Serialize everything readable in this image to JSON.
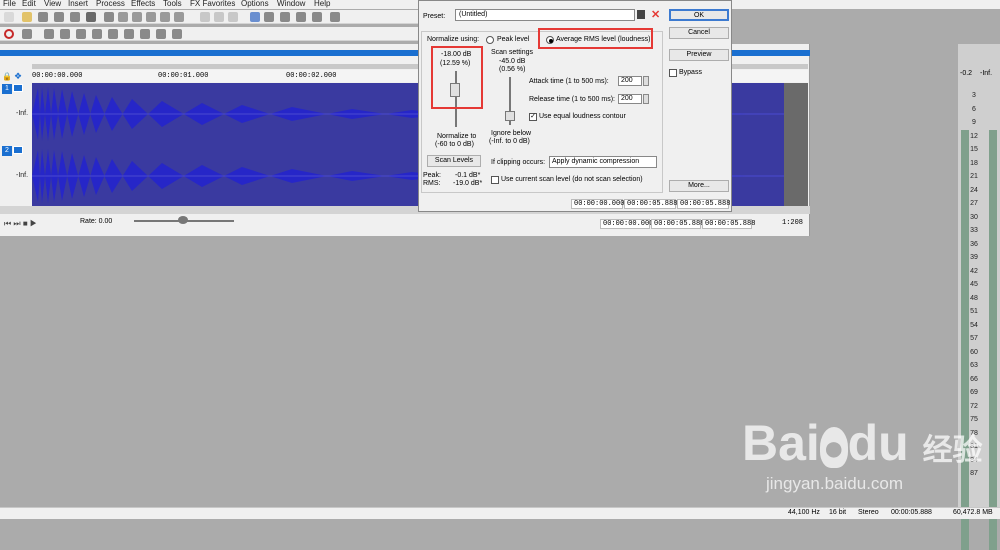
{
  "menu": [
    "File",
    "Edit",
    "View",
    "Insert",
    "Process",
    "Effects",
    "Tools",
    "FX Favorites",
    "Options",
    "Window",
    "Help"
  ],
  "timeline": {
    "ruler_ticks": [
      "00:00:00.000",
      "00:00:01.000",
      "00:00:02.000"
    ],
    "track1": {
      "number": "1",
      "peak_label": "-Inf."
    },
    "track2": {
      "number": "2",
      "peak_label": "-Inf."
    },
    "rate_label": "Rate: 0.00",
    "selection_start": "00:00:00.000",
    "selection_end": "00:00:05.888",
    "selection_length": "00:00:05.888",
    "zoom_ratio": "1:208"
  },
  "dialog": {
    "preset_label": "Preset:",
    "preset_value": "(Untitled)",
    "ok": "OK",
    "cancel": "Cancel",
    "preview": "Preview",
    "bypass": "Bypass",
    "more": "More...",
    "normalize_using": "Normalize using:",
    "normalize_db": "-18.00 dB",
    "normalize_pct": "(12.59 %)",
    "peak_level": "Peak level",
    "rms_level": "Average RMS level (loudness)",
    "scan_settings": "Scan settings",
    "scan_db": "-45.0 dB",
    "scan_pct": "(0.56 %)",
    "attack_label": "Attack time (1 to 500 ms):",
    "attack_value": "200",
    "release_label": "Release time (1 to 500 ms):",
    "release_value": "200",
    "equal_loudness": "Use equal loudness contour",
    "normalize_to_1": "Normalize to",
    "normalize_to_2": "(-60 to 0 dB)",
    "ignore_below_1": "Ignore below",
    "ignore_below_2": "(-Inf. to 0 dB)",
    "scan_levels": "Scan Levels",
    "peak_label": "Peak:",
    "peak_value": "-0.1 dB*",
    "rms_label": "RMS:",
    "rms_value": "-19.0 dB*",
    "clipping_label": "If clipping occurs:",
    "clipping_value": "Apply dynamic compression",
    "use_current_scan": "Use current scan level (do not scan selection)",
    "time_start": "00:00:00.000",
    "time_end": "00:00:05.888",
    "time_length": "00:00:05.888"
  },
  "meter": {
    "top_left": "-0.2",
    "top_right": "-Inf.",
    "scale": [
      "3",
      "6",
      "9",
      "12",
      "15",
      "18",
      "21",
      "24",
      "27",
      "30",
      "33",
      "36",
      "39",
      "42",
      "45",
      "48",
      "51",
      "54",
      "57",
      "60",
      "63",
      "66",
      "69",
      "72",
      "75",
      "78",
      "81",
      "84",
      "87"
    ]
  },
  "status": {
    "sample_rate": "44,100 Hz",
    "bit_depth": "16 bit",
    "channels": "Stereo",
    "length": "00:00:05.888",
    "free_space": "60,472.8 MB"
  },
  "watermark": {
    "brand": "Bai",
    "brand2": "du",
    "cn": "经验",
    "url": "jingyan.baidu.com"
  },
  "colors": {
    "waveform_bg": "#3a3aa0",
    "waveform": "#2626c8",
    "selection_blue": "#1a6fd0",
    "highlight_red": "#e53935"
  }
}
